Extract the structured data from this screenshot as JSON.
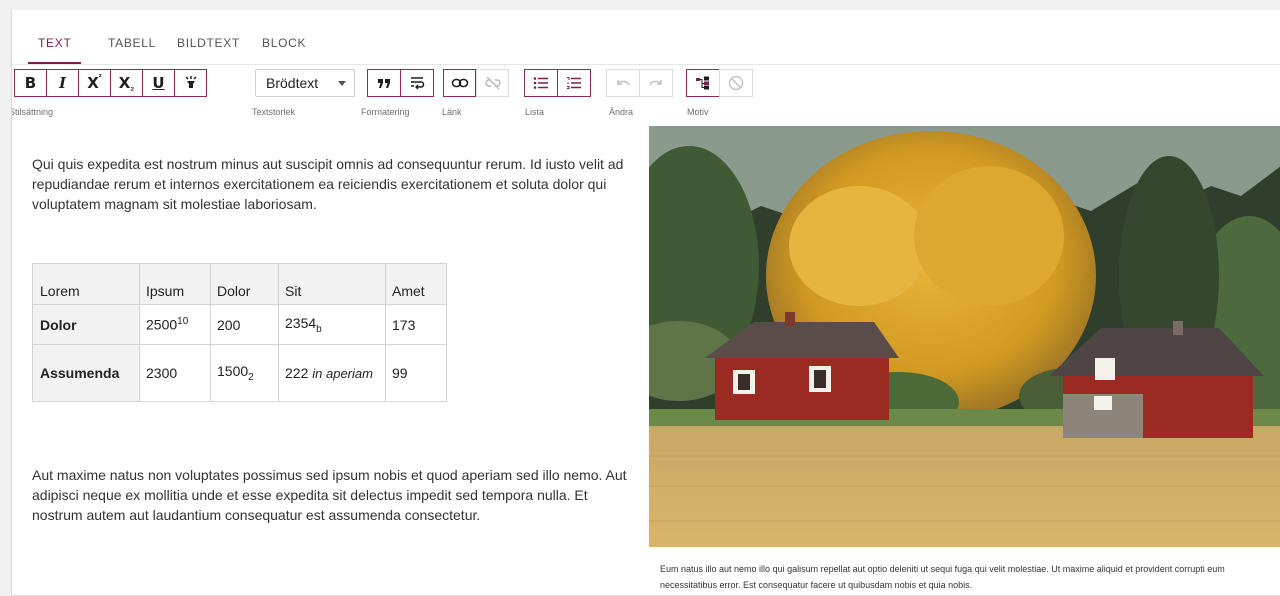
{
  "tabs": [
    "TEXT",
    "TABELL",
    "BILDTEXT",
    "BLOCK"
  ],
  "toolbar": {
    "groups": {
      "stilsattning": "Stilsättning",
      "textstorlek": "Textstorlek",
      "formatering": "Formatering",
      "lank": "Länk",
      "lista": "Lista",
      "andra": "Ändra",
      "motiv": "Motiv"
    },
    "bold": "B",
    "italic": "I",
    "superscript_base": "X",
    "superscript_mark": "²",
    "subscript_base": "X",
    "subscript_mark": "₂",
    "underline": "U",
    "text_size": "Brödtext"
  },
  "content": {
    "paragraph1": "Qui quis expedita est nostrum minus aut suscipit omnis ad consequuntur rerum. Id iusto velit ad repudiandae rerum et internos exercitationem ea reiciendis exercitationem et soluta dolor qui voluptatem magnam sit molestiae laboriosam.",
    "paragraph2": "Aut maxime natus non voluptates possimus sed ipsum nobis et quod aperiam sed illo nemo. Aut adipisci neque ex mollitia unde et esse expedita sit delectus impedit sed tempora nulla. Et nostrum autem aut laudantium consequatur est assumenda consectetur.",
    "table": {
      "headers": [
        "Lorem",
        "Ipsum",
        "Dolor",
        "Sit",
        "Amet"
      ],
      "rows": [
        {
          "label": "Dolor",
          "c1_base": "2500",
          "c1_sup": "10",
          "c2": "200",
          "c3_base": "2354",
          "c3_sub": "b",
          "c4": "173"
        },
        {
          "label": "Assumenda",
          "c1": "2300",
          "c2_base": "1500",
          "c2_sub": "2",
          "c3_a": "222",
          "c3_b": "in aperiam",
          "c4": "99"
        }
      ]
    },
    "caption": "Eum natus illo aut nemo illo qui galisum repellat aut optio deleniti ut sequi fuga qui velit molestiae. Ut maxime aliquid et provident corrupti eum necessitatibus error. Est consequatur facere ut quibusdam nobis et quia nobis."
  }
}
